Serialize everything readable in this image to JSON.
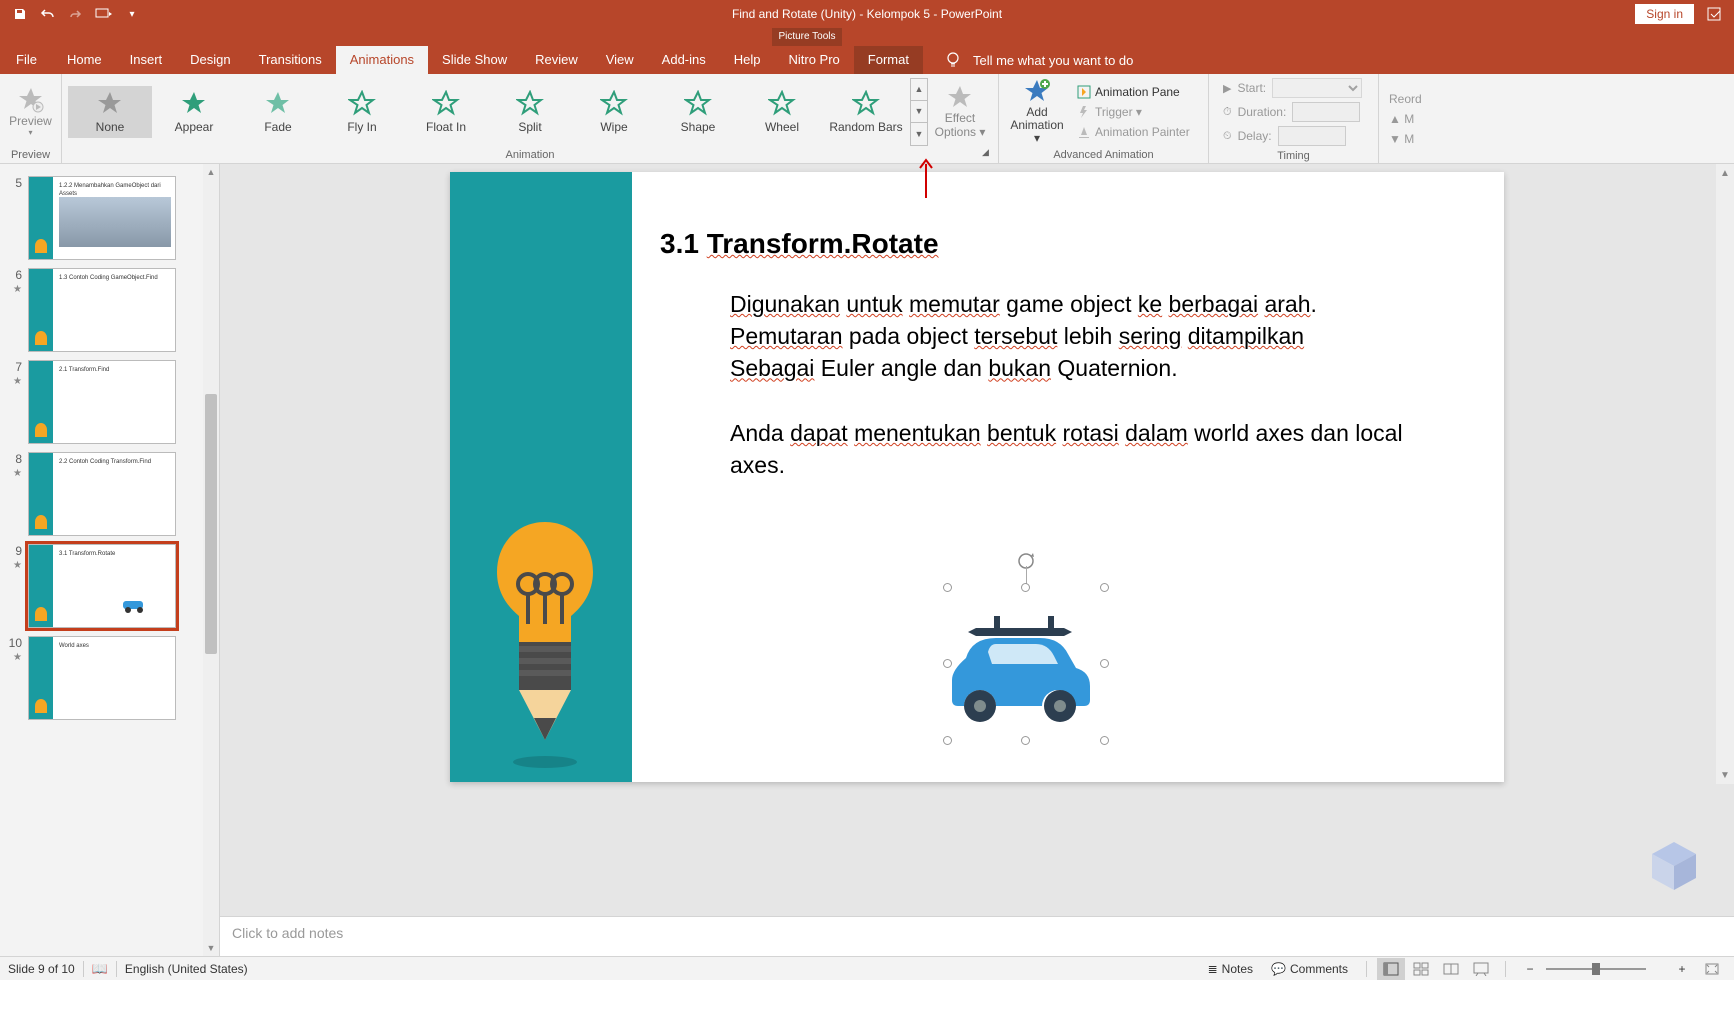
{
  "app": {
    "title": "Find and Rotate (Unity) - Kelompok 5  -  PowerPoint",
    "context_tool": "Picture Tools",
    "signin": "Sign in"
  },
  "tabs": {
    "file": "File",
    "home": "Home",
    "insert": "Insert",
    "design": "Design",
    "transitions": "Transitions",
    "animations": "Animations",
    "slideshow": "Slide Show",
    "review": "Review",
    "view": "View",
    "addins": "Add-ins",
    "help": "Help",
    "nitro": "Nitro Pro",
    "format": "Format",
    "tellme": "Tell me what you want to do"
  },
  "ribbon": {
    "preview": "Preview",
    "preview_group": "Preview",
    "animation_group": "Animation",
    "advanced_group": "Advanced Animation",
    "timing_group": "Timing",
    "effect_options": "Effect Options ▾",
    "add_animation": "Add Animation ▾",
    "animation_pane": "Animation Pane",
    "trigger": "Trigger ▾",
    "painter": "Animation Painter",
    "start": "Start:",
    "duration": "Duration:",
    "delay": "Delay:",
    "reorder": "Reord",
    "move_earlier": "M",
    "move_later": "M",
    "anims": [
      {
        "label": "None"
      },
      {
        "label": "Appear"
      },
      {
        "label": "Fade"
      },
      {
        "label": "Fly In"
      },
      {
        "label": "Float In"
      },
      {
        "label": "Split"
      },
      {
        "label": "Wipe"
      },
      {
        "label": "Shape"
      },
      {
        "label": "Wheel"
      },
      {
        "label": "Random Bars"
      }
    ]
  },
  "thumbnails": [
    {
      "num": "",
      "has_star": false,
      "title_preview": ""
    },
    {
      "num": "5",
      "has_star": false,
      "title_preview": "1.2.2 Menambahkan GameObject dari Assets"
    },
    {
      "num": "6",
      "has_star": true,
      "title_preview": "1.3 Contoh Coding GameObject.Find"
    },
    {
      "num": "7",
      "has_star": true,
      "title_preview": "2.1 Transform.Find"
    },
    {
      "num": "8",
      "has_star": true,
      "title_preview": "2.2 Contoh Coding Transform.Find"
    },
    {
      "num": "9",
      "has_star": true,
      "title_preview": "3.1 Transform.Rotate",
      "selected": true
    },
    {
      "num": "10",
      "has_star": true,
      "title_preview": "World axes"
    }
  ],
  "slide": {
    "title_prefix": "3.1 ",
    "title_underline": "Transform.Rotate",
    "body_l1_a": "Digunakan",
    "body_l1_b": "untuk",
    "body_l1_c": "memutar",
    "body_l1_d": " game object ",
    "body_l1_e": "ke",
    "body_l1_f": "berbagai",
    "body_l1_g": "arah",
    "body_l1_h": ". ",
    "body_l2_a": "Pemutaran",
    "body_l2_b": " pada object ",
    "body_l2_c": "tersebut",
    "body_l2_d": " lebih ",
    "body_l2_e": "sering",
    "body_l2_f": "ditampilkan",
    "body_l3_a": "Sebagai",
    "body_l3_b": " Euler angle dan ",
    "body_l3_c": "bukan",
    "body_l3_d": " Quaternion.",
    "body_l4_a": "Anda ",
    "body_l4_b": "dapat",
    "body_l4_c": "menentukan",
    "body_l4_d": "bentuk",
    "body_l4_e": "rotasi",
    "body_l4_f": "dalam",
    "body_l4_g": " world axes dan local axes."
  },
  "notes_placeholder": "Click to add notes",
  "status": {
    "slide_pos": "Slide 9 of 10",
    "language": "English (United States)",
    "notes": "Notes",
    "comments": "Comments"
  }
}
